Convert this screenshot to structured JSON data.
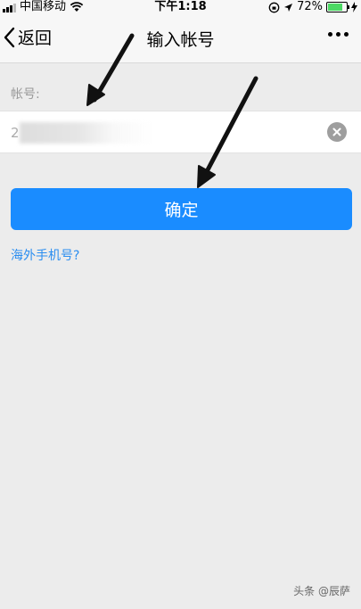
{
  "status_bar": {
    "carrier": "中国移动",
    "time": "下午1:18",
    "battery_percent": "72%",
    "battery_level": 0.72,
    "icons": [
      "signal-icon",
      "wifi-icon",
      "lock-rotation-icon",
      "location-icon",
      "battery-icon",
      "charging-icon"
    ]
  },
  "nav": {
    "back_label": "返回",
    "title": "输入帐号",
    "more_icon": "more-icon"
  },
  "form": {
    "account_label": "帐号:",
    "account_value": "2",
    "clear_icon": "clear-icon"
  },
  "confirm_label": "确定",
  "overseas_link": "海外手机号?",
  "watermark": "头条 @辰萨",
  "colors": {
    "primary": "#1a8cff",
    "link": "#2b8ef0",
    "background": "#ececec"
  }
}
